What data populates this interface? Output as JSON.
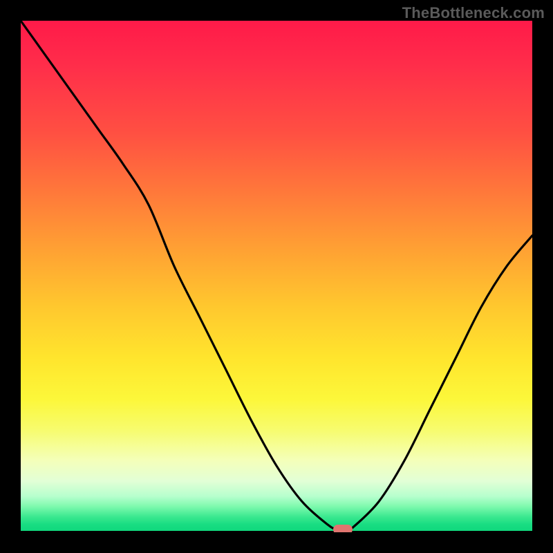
{
  "watermark": "TheBottleneck.com",
  "colors": {
    "background": "#000000",
    "curve": "#000000",
    "marker": "#e0756f",
    "gradient_top": "#ff1a49",
    "gradient_bottom": "#0fd67c"
  },
  "chart_data": {
    "type": "line",
    "title": "",
    "xlabel": "",
    "ylabel": "",
    "xlim": [
      0,
      100
    ],
    "ylim": [
      0,
      100
    ],
    "x": [
      0,
      5,
      10,
      15,
      20,
      25,
      30,
      35,
      40,
      45,
      50,
      55,
      60,
      62,
      64,
      65,
      70,
      75,
      80,
      85,
      90,
      95,
      100
    ],
    "values": [
      100,
      93,
      86,
      79,
      72,
      64,
      52,
      42,
      32,
      22,
      13,
      6,
      1.5,
      0.5,
      0.5,
      1,
      6,
      14,
      24,
      34,
      44,
      52,
      58
    ],
    "marker": {
      "x": 63,
      "y": 0.5
    },
    "legend": false,
    "grid": false
  }
}
